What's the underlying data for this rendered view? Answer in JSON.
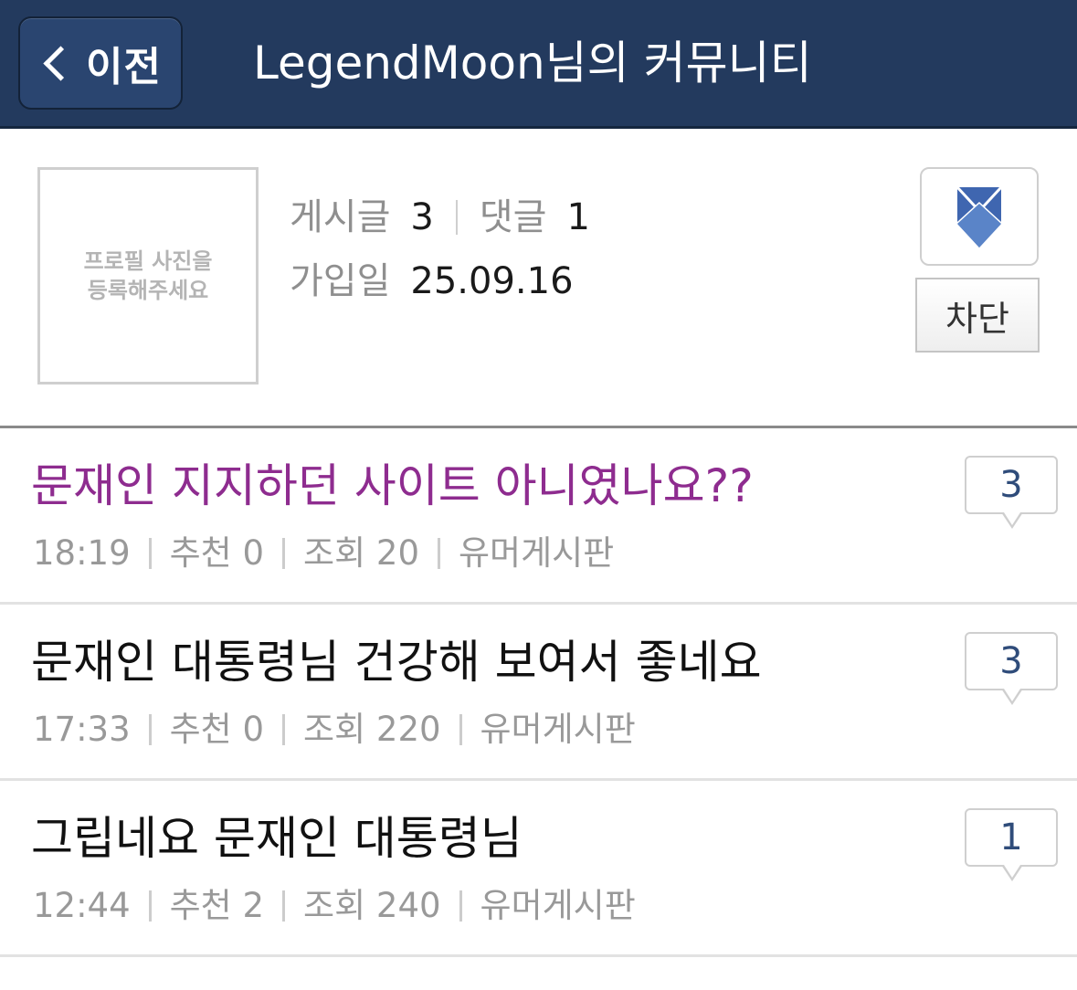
{
  "header": {
    "back_label": "이전",
    "title": "LegendMoon님의 커뮤니티"
  },
  "profile": {
    "avatar_placeholder": "프로필 사진을 등록해주세요",
    "posts_label": "게시글",
    "posts_count": "3",
    "comments_label": "댓글",
    "comments_count": "1",
    "joined_label": "가입일",
    "joined_date": "25.09.16",
    "badge_icon": "shield-icon",
    "block_label": "차단"
  },
  "posts": [
    {
      "title": "문재인 지지하던 사이트 아니였나요??",
      "time": "18:19",
      "recommend_label": "추천",
      "recommend": "0",
      "views_label": "조회",
      "views": "20",
      "board": "유머게시판",
      "comments": "3",
      "visited": true
    },
    {
      "title": "문재인 대통령님 건강해 보여서 좋네요",
      "time": "17:33",
      "recommend_label": "추천",
      "recommend": "0",
      "views_label": "조회",
      "views": "220",
      "board": "유머게시판",
      "comments": "3",
      "visited": false
    },
    {
      "title": "그립네요 문재인 대통령님",
      "time": "12:44",
      "recommend_label": "추천",
      "recommend": "2",
      "views_label": "조회",
      "views": "240",
      "board": "유머게시판",
      "comments": "1",
      "visited": false
    }
  ],
  "colors": {
    "header_bg": "#233a5e",
    "visited_title": "#8e2c8f",
    "comment_count": "#2f4c7a",
    "badge_blue": "#3f66b0"
  }
}
